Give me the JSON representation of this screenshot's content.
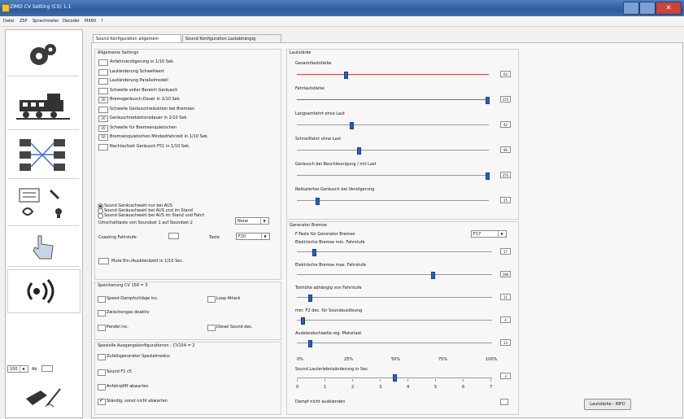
{
  "window": {
    "title": "ZIMO CV Setting (CS) 1.1"
  },
  "menu": [
    "Datei",
    "ZSP",
    "Sprachmeter",
    "Decoder",
    "MX60",
    "?"
  ],
  "tabs": [
    "Sound Konfiguration allgemein",
    "Sound Konfiguration Lastabhängig"
  ],
  "general": {
    "title": "Allgemeine Settings",
    "checks": [
      {
        "value": "",
        "label": "Anfahrverzögerung in 1/10 Sek."
      },
      {
        "value": "",
        "label": "Lautänderung Schwellwert"
      },
      {
        "value": "",
        "label": "Lautänderung Parallelmodell"
      },
      {
        "value": "",
        "label": "Schwelle voller Bereich Geräusch"
      },
      {
        "value": "20",
        "label": "Bremsgeräusch-Dauer in 1/10 Sek."
      },
      {
        "value": "",
        "label": "Schwelle Geräuschreduktion bei Bremsen"
      },
      {
        "value": "20",
        "label": "Geräuschreduktionsdauer in 1/10 Sek."
      },
      {
        "value": "20",
        "label": "Schwelle für Bremsenquietschen"
      },
      {
        "value": "50",
        "label": "Bremsenquietschen Mindestfahrzeit in 1/10 Sek."
      },
      {
        "value": "",
        "label": "Nachlaufzeit Geräusch F51 in 1/10 Sek."
      }
    ],
    "radios": [
      "Sound Geräuschwahl nur bei AUS",
      "Sound Geräuschwahl bei AUS und im Stand",
      "Sound Geräuschwahl bei AUS im Stand und Fahrt"
    ],
    "switch_label": "Umschalttaste von Soundset 1 auf Soundset 2",
    "switch_value": "None",
    "coasting_label": "Coasting Fahrstufe",
    "coasting_value": "",
    "taste_label": "Taste",
    "taste_value": "F20",
    "mute_label": "Mute Ein-/Ausblendzeit in 1/10 Sec.",
    "mute_value": ""
  },
  "cv158": {
    "title": "Speicherung CV 158 = 3",
    "items": [
      "Speed Dampfschläge inc.",
      "Loop Attack",
      "Zwischengas deaktiv",
      "Pendel inc.",
      "Diesel Sound dec."
    ]
  },
  "cv154": {
    "title": "Spezielle Ausgangskonfigurationen : CV154 = 2",
    "items": [
      "Zufallsgenerator Spezialmodus",
      "Sound F1 c5",
      "Anfahrpfiff abwarten",
      "Ständig, sonst nicht abwarten"
    ]
  },
  "volume": {
    "title": "Lautstärke",
    "sliders": [
      {
        "label": "Gesamtlautstärke",
        "value": "64",
        "pos": 0.25,
        "red": true
      },
      {
        "label": "Fahrlautstärke",
        "value": "255",
        "pos": 1.0,
        "red": true
      },
      {
        "label": "Langsamfahrt ohne Last",
        "value": "42",
        "pos": 0.28,
        "red": false
      },
      {
        "label": "Schnellfahrt ohne Last",
        "value": "90",
        "pos": 0.32,
        "red": false
      },
      {
        "label": "Geräusch bei Beschleunigung / mit Last",
        "value": "255",
        "pos": 1.0,
        "red": false
      },
      {
        "label": "Reduziertes Geräusch bei Verzögerung",
        "value": "25",
        "pos": 0.1,
        "red": false
      }
    ]
  },
  "generator": {
    "title": "Generator Bremse",
    "ftaste_label": "F-Taste für Generator Bremse",
    "ftaste_value": "F17",
    "sliders": [
      {
        "label": "Elektrische Bremse min. Fahrstufe",
        "value": "17",
        "pos": 0.08
      },
      {
        "label": "Elektrische Bremse max. Fahrstufe",
        "value": "180",
        "pos": 0.7
      },
      {
        "label": "Tonhöhe abhängig von Fahrstufe",
        "value": "11",
        "pos": 0.06
      },
      {
        "label": "min. F2 dec. für Soundauslösung",
        "value": "4",
        "pos": 0.02
      },
      {
        "label": "Ausblendschwelle reg. Motorlast",
        "value": "13",
        "pos": 0.06
      }
    ],
    "percent_ticks": [
      "0%",
      "25%",
      "50%",
      "75%",
      "100%"
    ],
    "delay_label": "Sound Lauterlebnisänderung in Sec.",
    "delay_value": "3",
    "delay_pos": 0.5,
    "delay_ticks": [
      "0",
      "1",
      "2",
      "3",
      "4",
      "5",
      "6",
      "7"
    ],
    "dampf_label": "Dampf nicht ausblenden"
  },
  "footer": {
    "info_button": "Lautstärke - INFO",
    "left_select": "100",
    "left_label": "Ab",
    "left_value": ""
  }
}
